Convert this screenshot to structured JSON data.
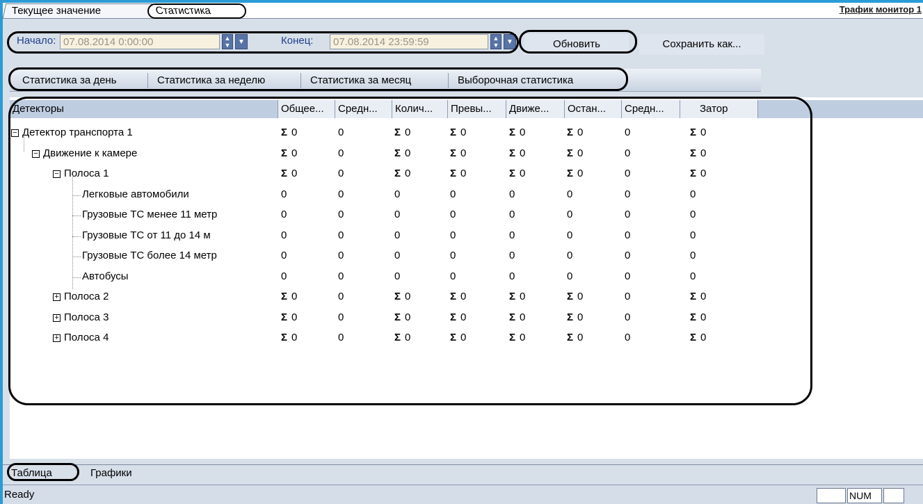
{
  "top_tabs": [
    "Текущее значение",
    "Статистика"
  ],
  "monitor_link": "Трафик монитор 1",
  "toolbar": {
    "start_label": "Начало:",
    "start_value": "07.08.2014 0:00:00",
    "end_label": "Конец:",
    "end_value": "07.08.2014 23:59:59",
    "refresh_label": "Обновить",
    "save_label": "Сохранить как..."
  },
  "period_tabs": [
    "Статистика за день",
    "Статистика за неделю",
    "Статистика за месяц",
    "Выборочная статистика"
  ],
  "columns": [
    "Детекторы",
    "Общее...",
    "Средн...",
    "Колич...",
    "Превы...",
    "Движе...",
    "Остан...",
    "Средн...",
    "Затор"
  ],
  "rows": [
    {
      "label": "Детектор транспорта 1",
      "level": 0,
      "expander": "−",
      "values": [
        "Σ 0",
        "0",
        "Σ 0",
        "Σ 0",
        "Σ 0",
        "Σ 0",
        "0",
        "Σ 0"
      ]
    },
    {
      "label": "Движение к камере",
      "level": 1,
      "expander": "−",
      "values": [
        "Σ 0",
        "0",
        "Σ 0",
        "Σ 0",
        "Σ 0",
        "Σ 0",
        "0",
        "Σ 0"
      ]
    },
    {
      "label": "Полоса 1",
      "level": 2,
      "expander": "−",
      "values": [
        "Σ 0",
        "0",
        "Σ 0",
        "Σ 0",
        "Σ 0",
        "Σ 0",
        "0",
        "Σ 0"
      ]
    },
    {
      "label": "Легковые автомобили",
      "level": 3,
      "expander": "",
      "values": [
        "0",
        "0",
        "0",
        "0",
        "0",
        "0",
        "0",
        "0"
      ]
    },
    {
      "label": "Грузовые ТС менее 11 метр",
      "level": 3,
      "expander": "",
      "values": [
        "0",
        "0",
        "0",
        "0",
        "0",
        "0",
        "0",
        "0"
      ]
    },
    {
      "label": "Грузовые ТС от 11 до 14 м",
      "level": 3,
      "expander": "",
      "values": [
        "0",
        "0",
        "0",
        "0",
        "0",
        "0",
        "0",
        "0"
      ]
    },
    {
      "label": "Грузовые ТС более 14 метр",
      "level": 3,
      "expander": "",
      "values": [
        "0",
        "0",
        "0",
        "0",
        "0",
        "0",
        "0",
        "0"
      ]
    },
    {
      "label": "Автобусы",
      "level": 3,
      "expander": "",
      "values": [
        "0",
        "0",
        "0",
        "0",
        "0",
        "0",
        "0",
        "0"
      ]
    },
    {
      "label": "Полоса 2",
      "level": 2,
      "expander": "+",
      "values": [
        "Σ 0",
        "0",
        "Σ 0",
        "Σ 0",
        "Σ 0",
        "Σ 0",
        "0",
        "Σ 0"
      ]
    },
    {
      "label": "Полоса 3",
      "level": 2,
      "expander": "+",
      "values": [
        "Σ 0",
        "0",
        "Σ 0",
        "Σ 0",
        "Σ 0",
        "Σ 0",
        "0",
        "Σ 0"
      ]
    },
    {
      "label": "Полоса 4",
      "level": 2,
      "expander": "+",
      "values": [
        "Σ 0",
        "0",
        "Σ 0",
        "Σ 0",
        "Σ 0",
        "Σ 0",
        "0",
        "Σ 0"
      ]
    }
  ],
  "bottom_tabs": [
    "Таблица",
    "Графики"
  ],
  "status": {
    "text": "Ready",
    "num": "NUM"
  }
}
